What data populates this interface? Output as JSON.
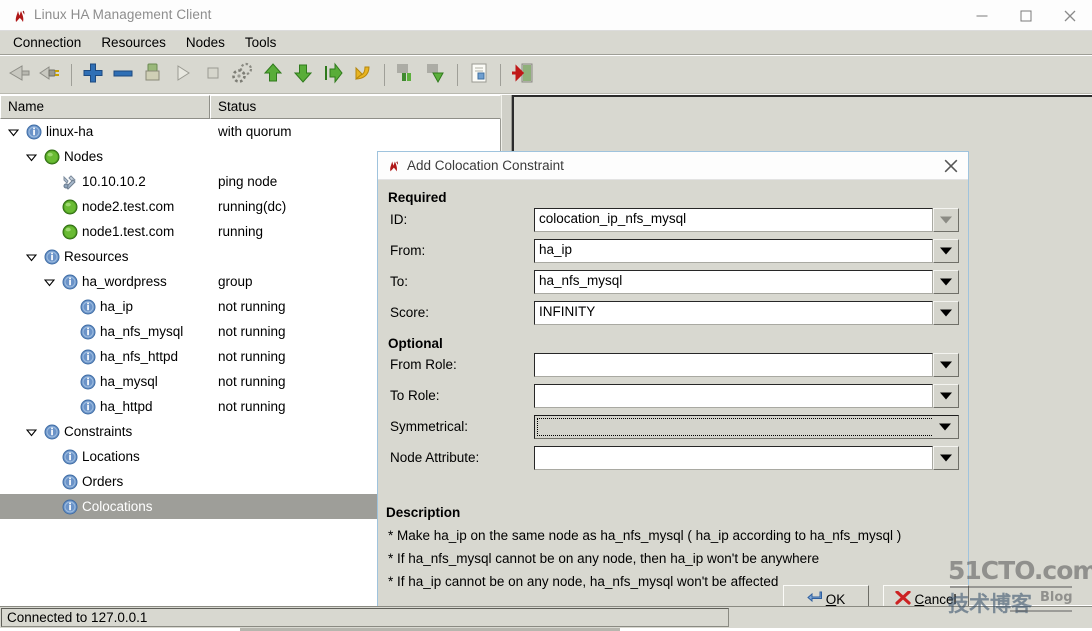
{
  "window": {
    "title": "Linux HA Management Client",
    "icon": "app-flame-icon",
    "controls": {
      "minimize": "minimize-icon",
      "maximize": "maximize-icon",
      "close": "close-icon"
    }
  },
  "menubar": {
    "items": [
      "Connection",
      "Resources",
      "Nodes",
      "Tools"
    ]
  },
  "toolbar": {
    "buttons": [
      {
        "name": "connect-icon",
        "title": "Connect"
      },
      {
        "name": "disconnect-icon",
        "title": "Disconnect"
      },
      {
        "name": "separator-1",
        "title": ""
      },
      {
        "name": "add-icon",
        "title": "Add"
      },
      {
        "name": "remove-icon",
        "title": "Remove"
      },
      {
        "name": "cleanup-icon",
        "title": "Cleanup Resource"
      },
      {
        "name": "start-icon",
        "title": "Start"
      },
      {
        "name": "stop-icon",
        "title": "Stop"
      },
      {
        "name": "manage-icon",
        "title": "Manage"
      },
      {
        "name": "move-up-icon",
        "title": "Move Up"
      },
      {
        "name": "move-down-icon",
        "title": "Move Down"
      },
      {
        "name": "migrate-icon",
        "title": "Migrate"
      },
      {
        "name": "unmigrate-icon",
        "title": "Unmigrate"
      },
      {
        "name": "separator-2",
        "title": ""
      },
      {
        "name": "standby-node-icon",
        "title": "Standby"
      },
      {
        "name": "active-node-icon",
        "title": "Activate"
      },
      {
        "name": "separator-3",
        "title": ""
      },
      {
        "name": "document-icon",
        "title": "Report"
      },
      {
        "name": "separator-4",
        "title": ""
      },
      {
        "name": "exit-icon",
        "title": "Exit"
      }
    ]
  },
  "tree": {
    "columns": [
      "Name",
      "Status"
    ],
    "rows": [
      {
        "label": "linux-ha",
        "status": "with quorum",
        "depth": 0,
        "icon": "info-icon",
        "twisty": "expanded",
        "selected": false
      },
      {
        "label": "Nodes",
        "status": "",
        "depth": 1,
        "icon": "green-ball-icon",
        "twisty": "expanded",
        "selected": false
      },
      {
        "label": "10.10.10.2",
        "status": "ping node",
        "depth": 2,
        "icon": "tools-icon",
        "twisty": "none",
        "selected": false
      },
      {
        "label": "node2.test.com",
        "status": "running(dc)",
        "depth": 2,
        "icon": "green-ball-icon",
        "twisty": "none",
        "selected": false
      },
      {
        "label": "node1.test.com",
        "status": "running",
        "depth": 2,
        "icon": "green-ball-icon",
        "twisty": "none",
        "selected": false
      },
      {
        "label": "Resources",
        "status": "",
        "depth": 1,
        "icon": "info-icon",
        "twisty": "expanded",
        "selected": false
      },
      {
        "label": "ha_wordpress",
        "status": "group",
        "depth": 2,
        "icon": "info-icon",
        "twisty": "expanded",
        "selected": false
      },
      {
        "label": "ha_ip",
        "status": "not running",
        "depth": 3,
        "icon": "info-icon",
        "twisty": "none",
        "selected": false
      },
      {
        "label": "ha_nfs_mysql",
        "status": "not running",
        "depth": 3,
        "icon": "info-icon",
        "twisty": "none",
        "selected": false
      },
      {
        "label": "ha_nfs_httpd",
        "status": "not running",
        "depth": 3,
        "icon": "info-icon",
        "twisty": "none",
        "selected": false
      },
      {
        "label": "ha_mysql",
        "status": "not running",
        "depth": 3,
        "icon": "info-icon",
        "twisty": "none",
        "selected": false
      },
      {
        "label": "ha_httpd",
        "status": "not running",
        "depth": 3,
        "icon": "info-icon",
        "twisty": "none",
        "selected": false
      },
      {
        "label": "Constraints",
        "status": "",
        "depth": 1,
        "icon": "info-icon",
        "twisty": "expanded",
        "selected": false
      },
      {
        "label": "Locations",
        "status": "",
        "depth": 2,
        "icon": "info-icon",
        "twisty": "none",
        "selected": false
      },
      {
        "label": "Orders",
        "status": "",
        "depth": 2,
        "icon": "info-icon",
        "twisty": "none",
        "selected": false
      },
      {
        "label": "Colocations",
        "status": "",
        "depth": 2,
        "icon": "info-icon",
        "twisty": "none",
        "selected": true
      }
    ]
  },
  "dialog": {
    "title": "Add Colocation Constraint",
    "icon": "app-flame-icon",
    "close": "close-icon",
    "sections": {
      "required": "Required",
      "optional": "Optional",
      "description": "Description"
    },
    "fields": [
      {
        "label": "ID:",
        "value": "colocation_ip_nfs_mysql",
        "name": "id-combo",
        "state": "disabled-arrow"
      },
      {
        "label": "From:",
        "value": "ha_ip",
        "name": "from-combo",
        "state": "normal"
      },
      {
        "label": "To:",
        "value": "ha_nfs_mysql",
        "name": "to-combo",
        "state": "normal"
      },
      {
        "label": "Score:",
        "value": "INFINITY",
        "name": "score-combo",
        "state": "normal"
      },
      {
        "label": "From Role:",
        "value": "",
        "name": "from-role-combo",
        "state": "normal"
      },
      {
        "label": "To Role:",
        "value": "",
        "name": "to-role-combo",
        "state": "normal"
      },
      {
        "label": "Symmetrical:",
        "value": "",
        "name": "symmetrical-combo",
        "state": "focused"
      },
      {
        "label": "Node Attribute:",
        "value": "",
        "name": "node-attribute-combo",
        "state": "normal"
      }
    ],
    "description_lines": [
      "* Make ha_ip  on the same node as ha_nfs_mysql   ( ha_ip according to ha_nfs_mysql )",
      "* If ha_nfs_mysql cannot be  on any node, then ha_ip won't be  anywhere",
      "* If ha_ip cannot be  on any node, ha_nfs_mysql won't be affected"
    ],
    "buttons": {
      "ok": {
        "label": "OK",
        "mnemonic": "O",
        "icon": "enter-arrow-icon"
      },
      "cancel": {
        "label": "Cancel",
        "mnemonic": "C",
        "icon": "red-x-icon"
      }
    }
  },
  "statusbar": {
    "text": "Connected to 127.0.0.1"
  },
  "watermark": {
    "line1": "51CTO.com",
    "line2": "技术博客",
    "line3": "Blog"
  },
  "colors": {
    "chrome": "#d8d8d0",
    "accent_blue": "#3a6ea5",
    "green": "#5cb02c",
    "dialog_border": "#9fc3dd",
    "selection": "#9e9e99"
  }
}
